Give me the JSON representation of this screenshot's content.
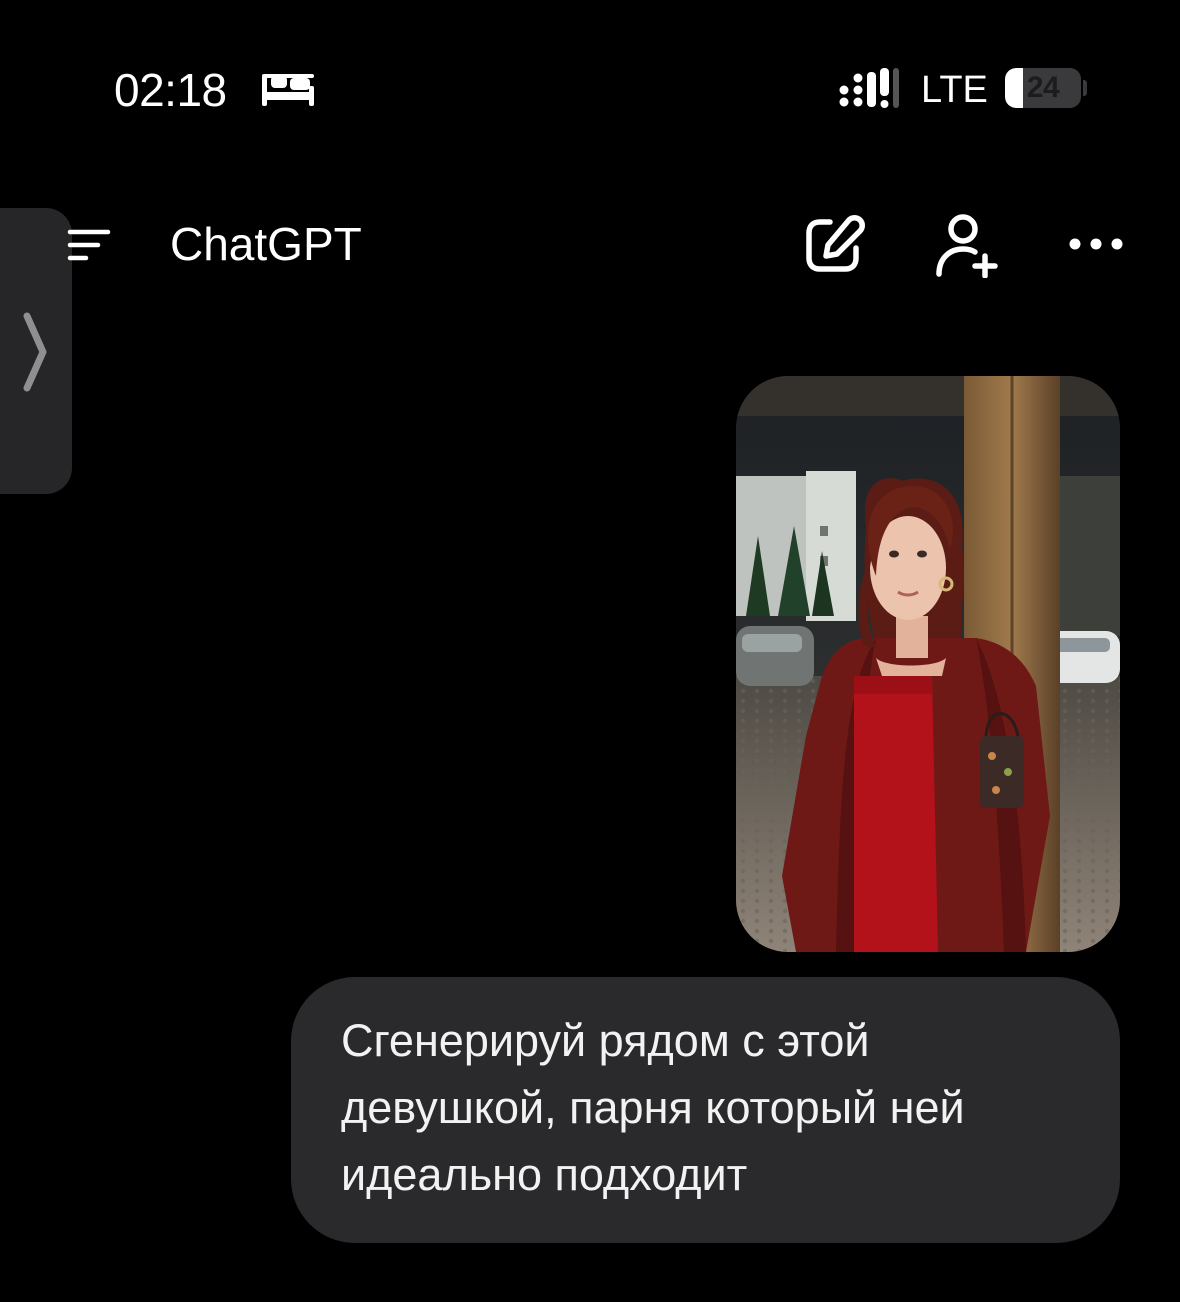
{
  "status_bar": {
    "time": "02:18",
    "sleep_icon": "bed-icon",
    "signal_icon": "cellular-signal-icon",
    "network": "LTE",
    "battery_level": "24",
    "battery_fraction": 0.24
  },
  "header": {
    "title": "ChatGPT",
    "menu_icon": "menu-icon",
    "sidebar_toggle_icon": "chevron-right-icon",
    "new_chat_icon": "edit-icon",
    "add_user_icon": "person-add-icon",
    "more_icon": "more-horizontal-icon"
  },
  "conversation": {
    "messages": [
      {
        "role": "user",
        "attachment": "photo",
        "text": "Сгенерируй рядом с этой девушкой, парня который ней идеально подходит"
      }
    ]
  },
  "colors": {
    "background": "#000000",
    "bubble": "#2a2a2c",
    "sidebar_tab": "#262628",
    "text": "#ffffff"
  }
}
